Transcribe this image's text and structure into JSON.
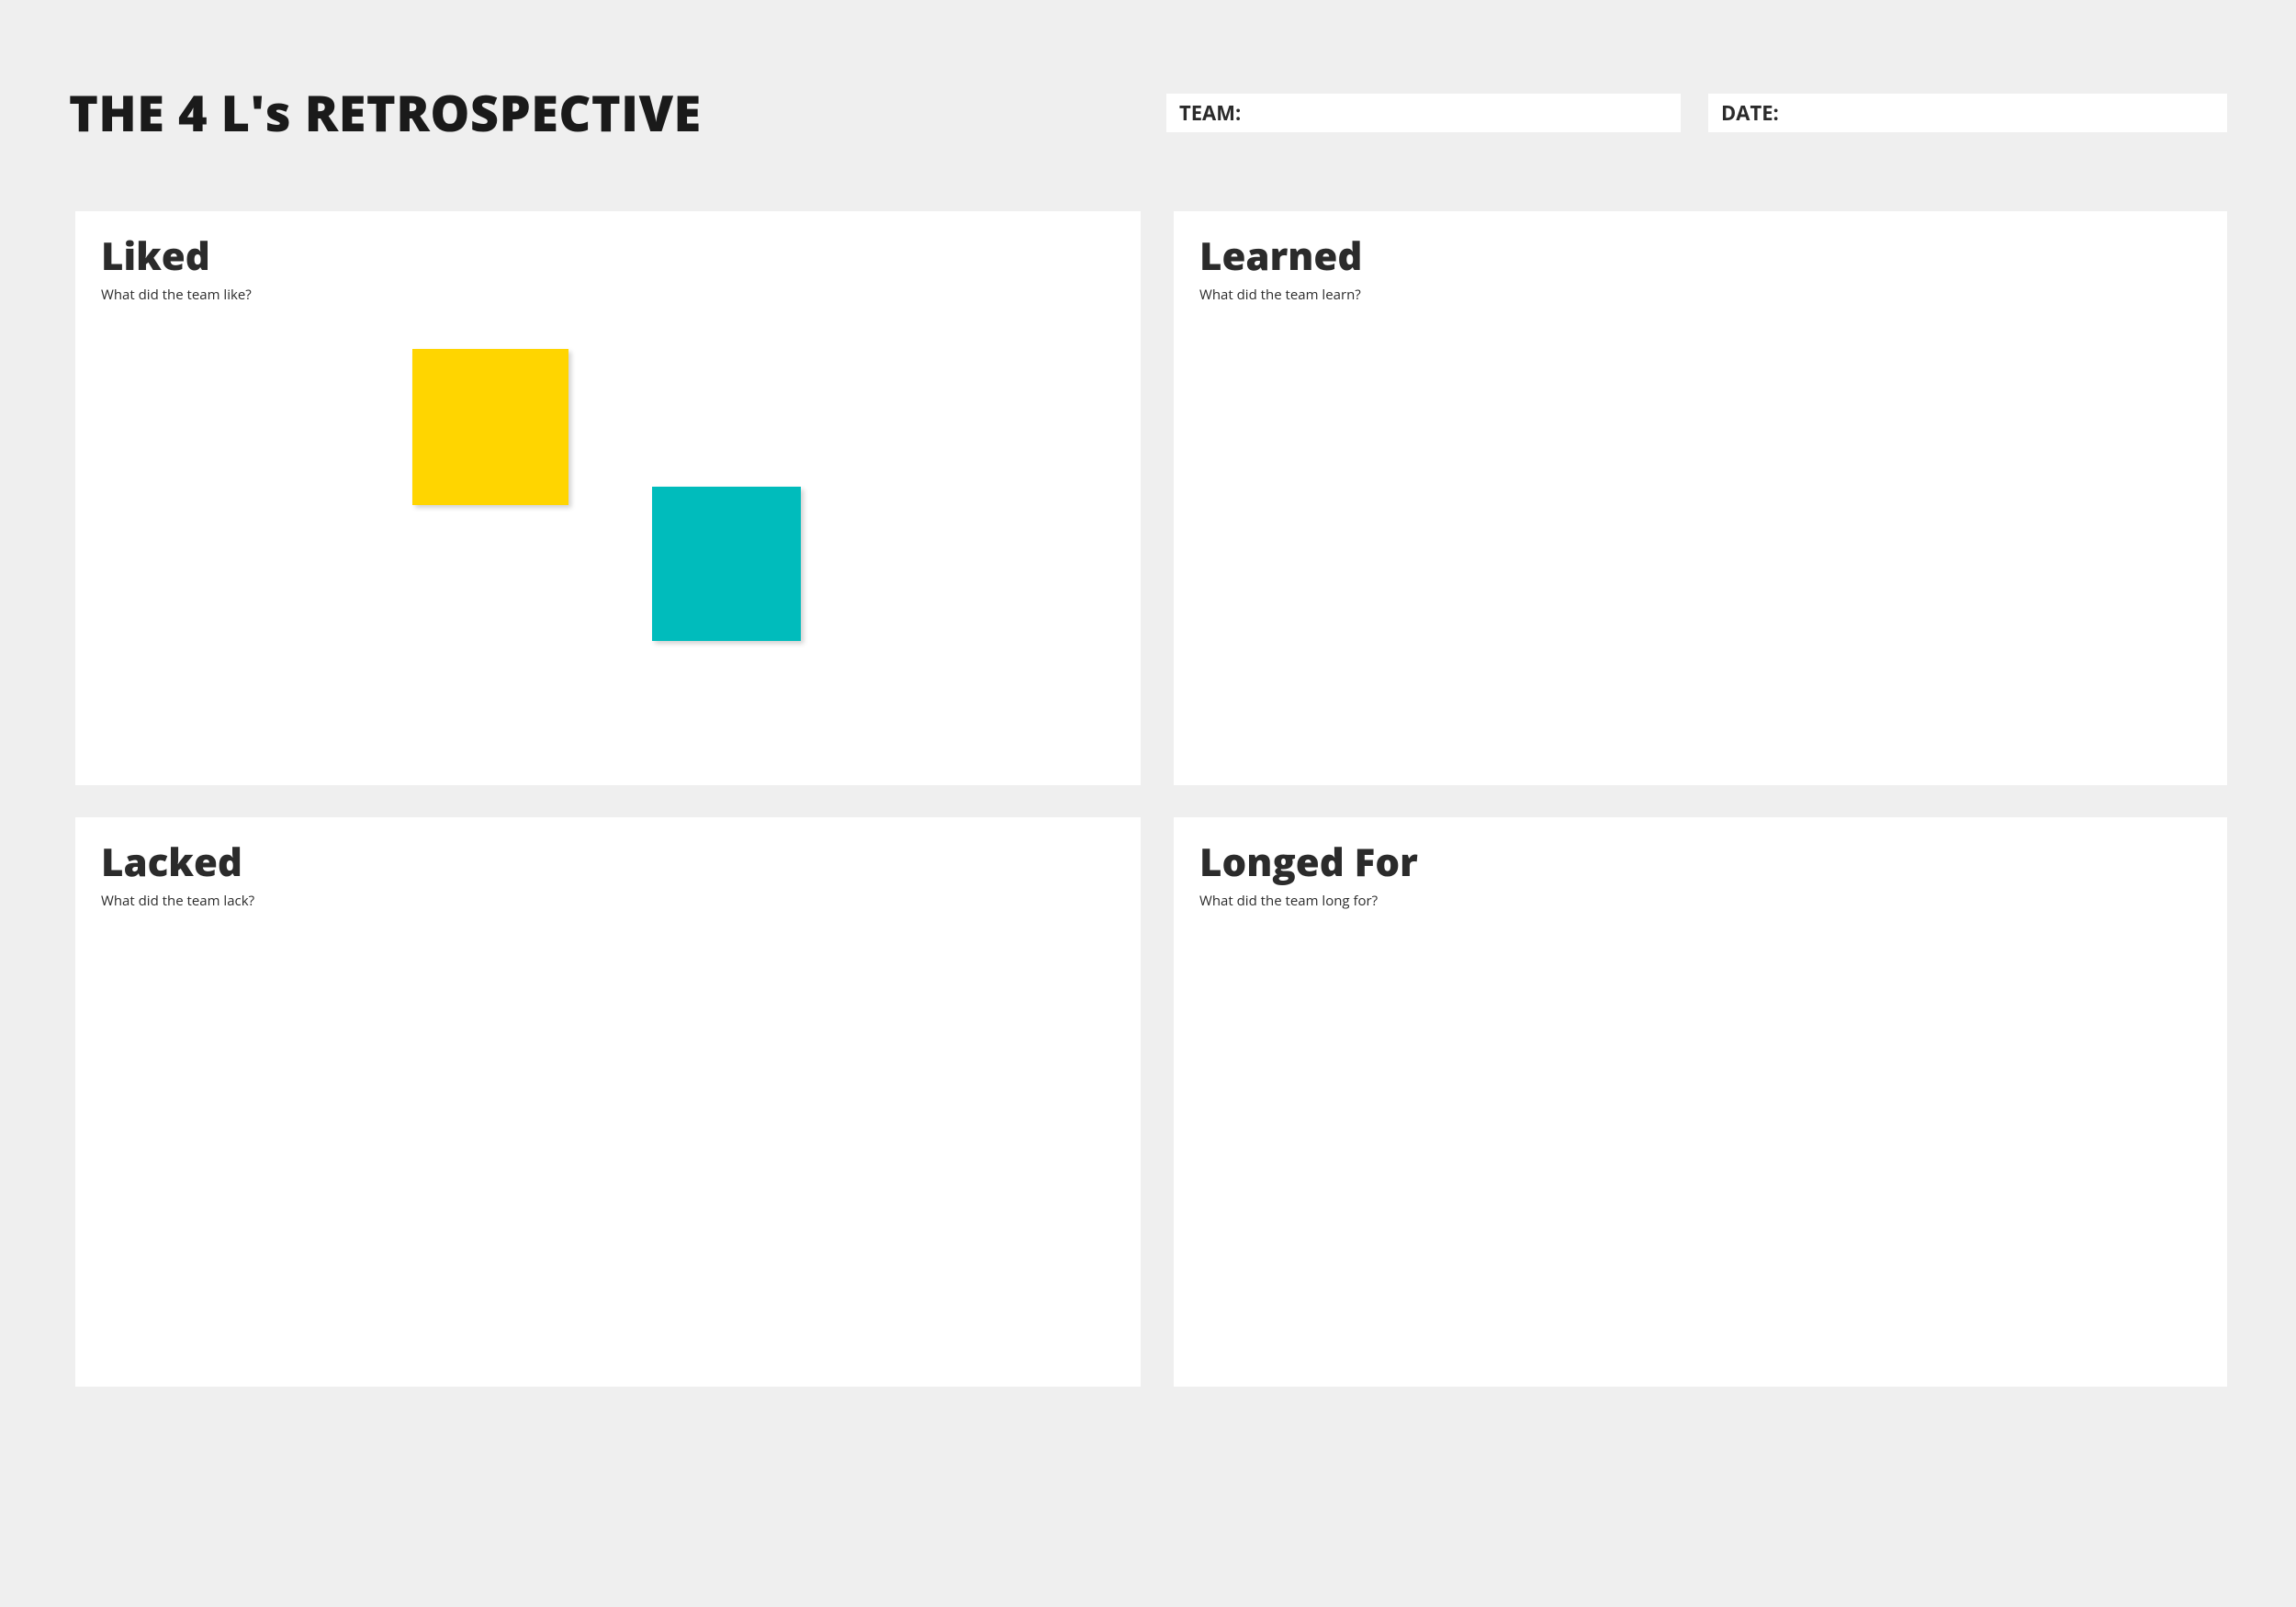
{
  "header": {
    "title": "THE 4 L's RETROSPECTIVE",
    "team_label": "TEAM:",
    "team_value": "",
    "date_label": "DATE:",
    "date_value": ""
  },
  "quadrants": {
    "liked": {
      "title": "Liked",
      "subtitle": "What did the team like?"
    },
    "learned": {
      "title": "Learned",
      "subtitle": "What did the team learn?"
    },
    "lacked": {
      "title": "Lacked",
      "subtitle": "What did the team lack?"
    },
    "longed": {
      "title": "Longed For",
      "subtitle": "What did the team long for?"
    }
  },
  "stickies": [
    {
      "color": "#ffd500",
      "name": "yellow",
      "quadrant": "liked"
    },
    {
      "color": "#00bcbc",
      "name": "teal",
      "quadrant": "liked"
    }
  ]
}
